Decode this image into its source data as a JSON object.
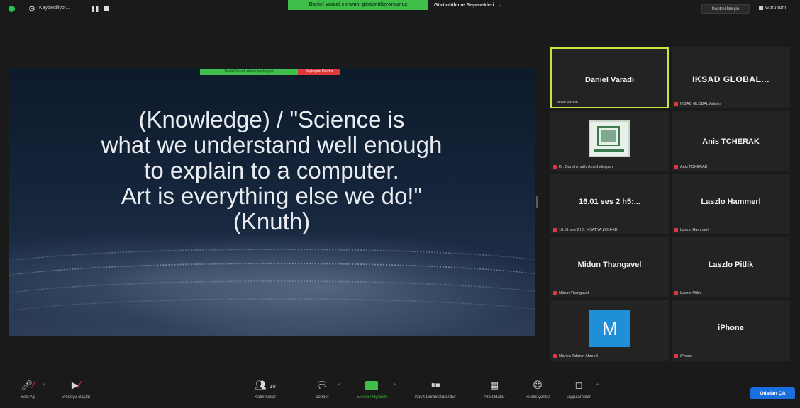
{
  "topbar": {
    "recording_label": "Kaydediliyor...",
    "share_banner": "Daniel Varadi ekranını görüntülüyorsunuz",
    "view_options": "Görüntüleme Seçenekleri",
    "control_button": "Kontrol İsteyin",
    "gallery_label": "Görünüm"
  },
  "share_control": {
    "status": "Daniel Varadi ekranı paylaşıyor",
    "stop": "Paylaşımı Durdur"
  },
  "slide": {
    "lines": [
      "(Knowledge) / \"Science is",
      "what we understand well enough",
      "to explain to a computer.",
      "Art is everything else we do!\"",
      "(Knuth)"
    ]
  },
  "participants": [
    {
      "name": "Daniel Varadi",
      "label": "Daniel Varadi",
      "muted": false,
      "active": true
    },
    {
      "name": "IKSAD GLOBAL...",
      "label": "IKSAD GLOBAL Admin",
      "muted": true
    },
    {
      "name": "",
      "label": "Dr. Gandhimathi Amirthalingam",
      "muted": true,
      "avatar": "logo-image"
    },
    {
      "name": "Anis TCHERAK",
      "label": "Anis TCHERAK",
      "muted": true
    },
    {
      "name": "16.01 ses 2 h5:...",
      "label": "16.01 ses 2 h5: HSATYA ZOUHIDI",
      "muted": true
    },
    {
      "name": "Laszlo Hammerl",
      "label": "Laszlo Hammerl",
      "muted": true
    },
    {
      "name": "Midun Thangavel",
      "label": "Midun Thangavel",
      "muted": true
    },
    {
      "name": "Laszlo Pitlik",
      "label": "Laszlo Pitlik",
      "muted": true
    },
    {
      "name": "",
      "label": "Mariea Tahmin Ahmed",
      "muted": true,
      "avatar_letter": "M"
    },
    {
      "name": "iPhone",
      "label": "iPhone",
      "muted": true
    }
  ],
  "toolbar": {
    "mute": "Sesi Aç",
    "video": "Videoyu Başlat",
    "participants": "Katılımcılar",
    "participants_count": "10",
    "chat": "Sohbet",
    "share": "Ekranı Paylaşın",
    "record": "Kayıt Duraklat/Durdur",
    "breakout": "Ara Odalar",
    "reactions": "Reaksiyonlar",
    "apps": "Uygulamalar",
    "end": "Odadan Çık"
  },
  "colors": {
    "green": "#3fbf4a",
    "red": "#e0393b",
    "active_border": "#cfe13a",
    "end_button": "#1a6fe0"
  }
}
